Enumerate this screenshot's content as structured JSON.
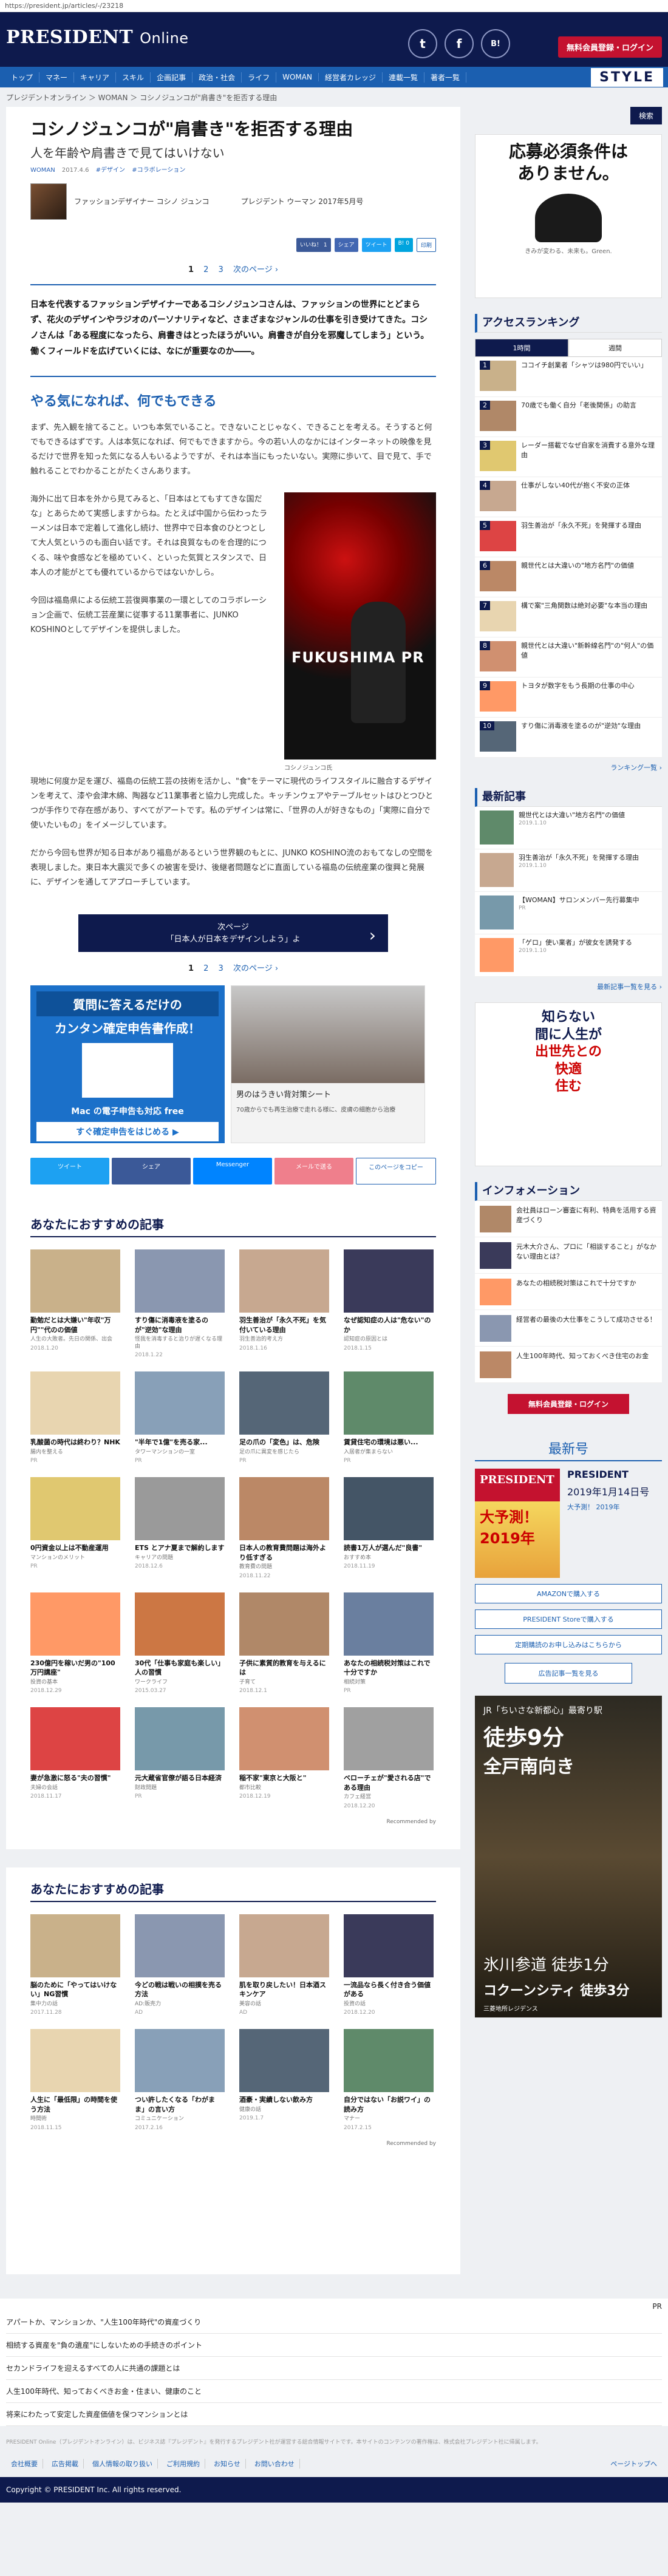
{
  "url": "https://president.jp/articles/-/23218",
  "header": {
    "logo_main": "PRESIDENT",
    "logo_sub": "Online",
    "twitter_icon": "t",
    "facebook_icon": "f",
    "hatena_icon": "B!",
    "login": "無料会員登録・ログイン"
  },
  "nav": [
    "トップ",
    "マネー",
    "キャリア",
    "スキル",
    "企画記事",
    "政治・社会",
    "ライフ",
    "WOMAN",
    "経営者カレッジ",
    "連載一覧",
    "著者一覧"
  ],
  "nav_style": "STYLE",
  "breadcrumb": "プレジデントオンライン ＞ WOMAN ＞ コシノジュンコが\"肩書き\"を拒否する理由",
  "article": {
    "title": "コシノジュンコが\"肩書き\"を拒否する理由",
    "subtitle": "人を年齢や肩書きで見てはいけない",
    "tags": [
      "WOMAN",
      "2017.4.6",
      "#デザイン",
      "#コラボレーション"
    ],
    "author": "ファッションデザイナー コシノ ジュンコ",
    "source": "プレジデント ウーマン 2017年5月号",
    "share": [
      "いいね！ 1",
      "シェア",
      "ツイート",
      "B! 0",
      "印刷"
    ],
    "pager": {
      "current": "1",
      "p2": "2",
      "p3": "3",
      "next": "次のページ ›"
    },
    "lead": "日本を代表するファッションデザイナーであるコシノジュンコさんは、ファッションの世界にとどまらず、花火のデザインやラジオのパーソナリティなど、さまざまなジャンルの仕事を引き受けてきた。コシノさんは「ある程度になったら、肩書きはとったほうがいい。肩書きが自分を邪魔してしまう」という。働くフィールドを広げていくには、なにが重要なのか――。",
    "h2": "やる気になれば、何でもできる",
    "p1": "まず、先入観を捨てること。いつも本気でいること。できないことじゃなく、できることを考える。そうすると何でもできるはずです。人は本気になれば、何でもできますから。今の若い人のなかにはインターネットの映像を見るだけで世界を知った気になる人もいるようですが、それは本当にもったいない。実際に歩いて、目で見て、手で触れることでわかることがたくさんあります。",
    "p2": "海外に出て日本を外から見てみると、「日本はとてもすてきな国だな」とあらためて実感しますからね。たとえば中国から伝わったラーメンは日本で定着して進化し続け、世界中で日本食のひとつとして大人気というのも面白い話です。それは良質なものを合理的につくる、味や食感などを極めていく、といった気質とスタンスで、日本人の才能がとても優れているからではないかしら。",
    "p3": "今回は福島県による伝統工芸復興事業の一環としてのコラボレーション企画で、伝統工芸産業に従事する11業事者に、JUNKO KOSHINOとしてデザインを提供しました。",
    "p4": "現地に何度か足を運び、福島の伝統工芸の技術を活かし、\"食\"をテーマに現代のライフスタイルに融合するデザインを考えて、漆や会津木綿、陶器など11業事者と協力し完成した。キッチンウェアやテーブルセットはひとつひとつが手作りで存在感があり、すべてがアートです。私のデザインは常に、「世界の人が好きなもの」「実際に自分で使いたいもの」をイメージしています。",
    "p5": "だから今回も世界が知る日本があり福島があるという世界観のもとに、JUNKO KOSHINO流のおもてなしの空間を表現しました。東日本大震災で多くの被害を受け、後継者問題などに直面している福島の伝統産業の復興と発展に、デザインを通してアプローチしています。",
    "photo_text": "FUKUSHIMA PR",
    "caption": "コシノジュンコ氏",
    "next_label": "次ページ",
    "next_title": "「日本人が日本をデザインしよう」よ"
  },
  "ads": {
    "a1_top": "質問に答えるだけの",
    "a1_main": "カンタン確定申告書作成！",
    "a1_sub": "Mac の電子申告も対応 free",
    "a1_btn": "すぐ確定申告をはじめる ▶",
    "a2_title": "男のはうきい背対策シート",
    "a2_sub": "70歳からでも再生治療で走れる様に、皮膚の細胞から治療"
  },
  "share_big": [
    "ツイート",
    "シェア",
    "Messenger",
    "メールで送る",
    "このページをコピー"
  ],
  "rec1": {
    "title": "あなたにおすすめの記事",
    "cards": [
      {
        "t": "勤勉だとは大嫌い\"年収\"万円\"\"代のの価値",
        "s": "人生の大敗者。先日の関係、出会",
        "d": "2018.1.20"
      },
      {
        "t": "すり傷に消毒液を塗るのが\"逆効\"な理由",
        "s": "怪我を消毒すると治りが遅くなる理由",
        "d": "2018.1.22"
      },
      {
        "t": "羽生善治が「永久不死」を気付いている理由",
        "s": "羽生善治的考え方",
        "d": "2018.1.16"
      },
      {
        "t": "なぜ認知症の人は\"危ない\"のか",
        "s": "認知症の原因とは",
        "d": "2018.1.15"
      },
      {
        "t": "乳酸菌の時代は終わり？NHK",
        "s": "腸内を整える",
        "d": "PR"
      },
      {
        "t": "\"半年で1億\"を売る家...",
        "s": "タワーマンションの一室",
        "d": "PR"
      },
      {
        "t": "足の爪の「変色」は、危険",
        "s": "足の爪に異変を感じたら",
        "d": "PR"
      },
      {
        "t": "賃貸住宅の環境は悪い...",
        "s": "入居者が集まらない",
        "d": "PR"
      },
      {
        "t": "0円資金以上は不動産運用",
        "s": "マンションのメリット",
        "d": "PR"
      },
      {
        "t": "ETS とアナ夏まで解約します",
        "s": "キャリアの問題",
        "d": "2018.12.6"
      },
      {
        "t": "日本人の教育費問題は海外より低すぎる",
        "s": "教育費の問題",
        "d": "2018.11.22"
      },
      {
        "t": "読書1万人が選んだ\"良書\"",
        "s": "おすすめ本",
        "d": "2018.11.19"
      },
      {
        "t": "230億円を稼いだ男の\"100万円講座\"",
        "s": "投資の基本",
        "d": "2018.12.29"
      },
      {
        "t": "30代「仕事も家庭も楽しい」人の習慣",
        "s": "ワークライフ",
        "d": "2015.03.27"
      },
      {
        "t": "子供に素質的教育を与えるには",
        "s": "子育て",
        "d": "2018.12.1"
      },
      {
        "t": "あなたの相続税対策はこれで十分ですか",
        "s": "相続対策",
        "d": "PR"
      },
      {
        "t": "妻が急激に怒る\"夫の習慣\"",
        "s": "夫婦の会話",
        "d": "2018.11.17"
      },
      {
        "t": "元大蔵省官僚が語る日本経済",
        "s": "財政問題",
        "d": "PR"
      },
      {
        "t": "稲不家\"東京と大阪と\"",
        "s": "都市比較",
        "d": "2018.12.19"
      },
      {
        "t": "ベローチェが\"愛される店\"である理由",
        "s": "カフェ経営",
        "d": "2018.12.20"
      }
    ],
    "footer": "Recommended by"
  },
  "rec2": {
    "title": "あなたにおすすめの記事",
    "cards": [
      {
        "t": "脳のために「やってはいけない」NG習慣",
        "s": "集中力の話",
        "d": "2017.11.28"
      },
      {
        "t": "今どの戦は戦いの相撲を売る方法",
        "s": "AD:販売力",
        "d": "AD"
      },
      {
        "t": "肌を取り戻したい！日本酒スキンケア",
        "s": "美容の話",
        "d": "AD"
      },
      {
        "t": "一流品なら長く付き合う価値がある",
        "s": "投資の話",
        "d": "2018.12.20"
      },
      {
        "t": "人生に「最低限」の時間を使う方法",
        "s": "時間術",
        "d": "2018.11.15"
      },
      {
        "t": "つい許したくなる「わがまま」の言い方",
        "s": "コミュニケーション",
        "d": "2017.2.16"
      },
      {
        "t": "酒豪・実績しない飲み方",
        "s": "健康の話",
        "d": "2019.1.7"
      },
      {
        "t": "自分ではない「お説ワイ」の読み方",
        "s": "マナー",
        "d": "2017.2.15"
      }
    ],
    "footer": "Recommended by"
  },
  "side": {
    "search": "検索",
    "ad_text": [
      "応募必須条件は",
      "ありません。"
    ],
    "ad_foot": "きみが変わる、未来も。Green.",
    "ranking_title": "アクセスランキング",
    "tab1": "1時間",
    "tab2": "週間",
    "ranking": [
      "ココイチ創業者「シャツは980円でいい」",
      "70歳でも働く自分「老後関係」の助言",
      "レーダー搭載でなぜ自家を消費する意外な理由",
      "仕事がしない40代が抱く不安の正体",
      "羽生善治が「永久不死」を発揮する理由",
      "親世代とは大違いの\"地方名門\"の価値",
      "構で案\"三角関数は絶対必要\"な本当の理由",
      "親世代とは大違い\"新幹線名門\"の\"何人\"の価値",
      "トヨタが数字をもう長期の仕事の中心",
      "すり傷に消毒液を塗るのが\"逆効\"な理由"
    ],
    "ranking_more": "ランキング一覧 ›",
    "new_title": "最新記事",
    "new": [
      {
        "t": "親世代とは大違い\"地方名門\"の価値",
        "d": "2019.1.10"
      },
      {
        "t": "羽生善治が「永久不死」を発揮する理由",
        "d": "2019.1.10"
      },
      {
        "t": "【WOMAN】サロンメンバー先行募集中",
        "d": "PR"
      },
      {
        "t": "「ゲロ」使い業者」が彼女を誘発する",
        "d": "2019.1.10"
      }
    ],
    "new_more": "最新記事一覧を見る ›",
    "bigad": [
      "知らない",
      "間に人生が",
      "出世先との",
      "快適",
      "住む"
    ],
    "info_title": "インフォメーション",
    "info": [
      "会社員はローン審査に有利、特典を活用する資産づくり",
      "元木大介さん、プロに「相談すること」がなかない理由とは？",
      "あなたの相続税対策はこれで十分ですか",
      "経営者の最後の大仕事をこうして成功させる！",
      "人生100年時代、知っておくべき住宅のお金"
    ],
    "login": "無料会員登録・ログイン",
    "latest_title": "最新号",
    "mag_name": "PRESIDENT",
    "mag_date": "2019年1月14日号",
    "mag_link": "大予測！ 2019年",
    "cover_n": "PRESIDENT",
    "cover_b": "大予測！2019年",
    "buy_btns": [
      "AMAZONで購入する",
      "PRESIDENT Storeで購入する",
      "定期購読のお申し込みはこちらから"
    ],
    "adlist": "広告記事一覧を見る",
    "estate": [
      "JR「ちいさな新都心」最寄り駅",
      "徒歩9分",
      "全戸南向き",
      "氷川参道 徒歩1分",
      "コクーンシティ 徒歩3分",
      "三菱地所レジデンス"
    ]
  },
  "links": {
    "pr": "PR",
    "items": [
      "アパートか、マンションか、\"人生100年時代\"の資産づくり",
      "相続する資産を\"負の遺産\"にしないための手続きのポイント",
      "セカンドライフを迎えるすべての人に共通の課題とは",
      "人生100年時代、知っておくべきお金・住まい、健康のこと",
      "将来にわたって安定した資産価値を保つマンションとは"
    ]
  },
  "footer": {
    "disclaimer": "PRESIDENT Online（プレジデントオンライン）は、ビジネス誌『プレジデント』を発行するプレジデント社が運営する総合情報サイトです。本サイトのコンテンツの著作権は、株式会社プレジデント社に帰属します。",
    "nav": [
      "会社概要",
      "広告掲載",
      "個人情報の取り扱い",
      "ご利用規約",
      "お知らせ",
      "お問い合わせ"
    ],
    "top": "ページトップへ",
    "copy": "Copyright © PRESIDENT Inc. All rights reserved."
  },
  "colors": {
    "navy": "#0e1a4d",
    "blue": "#1b5fb0",
    "red": "#c41230"
  }
}
